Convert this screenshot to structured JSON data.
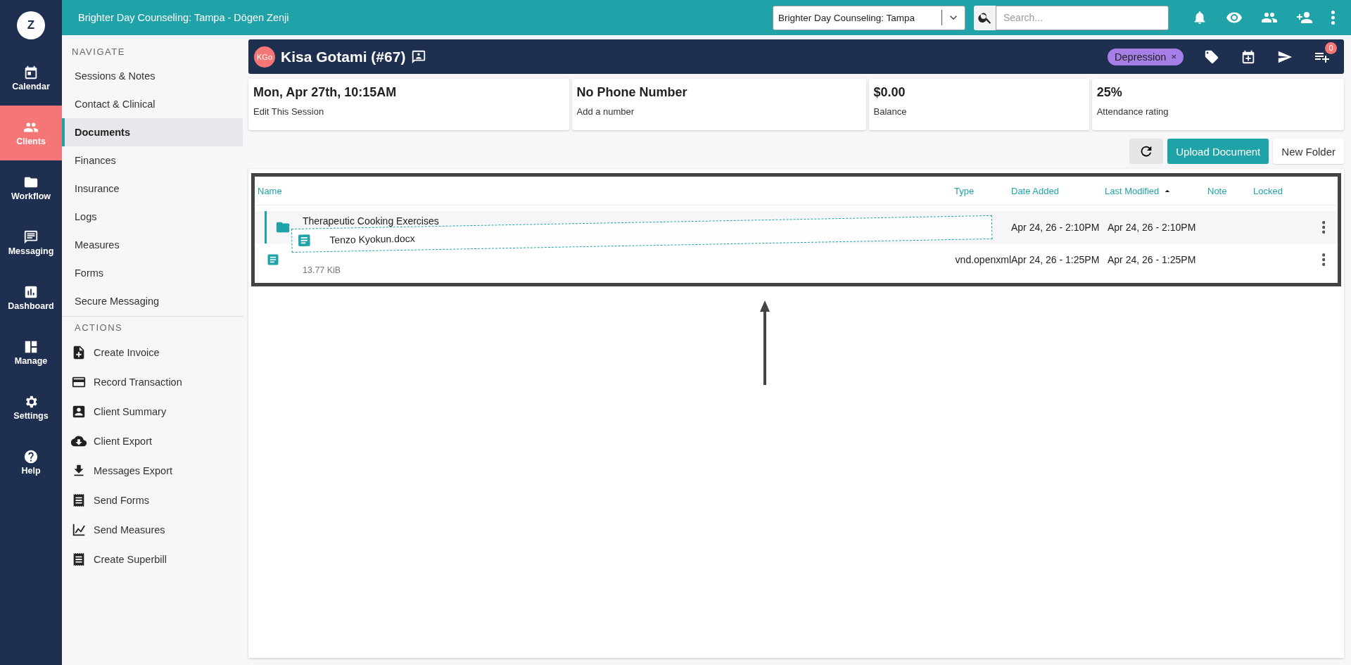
{
  "rail": {
    "logo": "Z",
    "items": [
      {
        "kind": "calendar",
        "label": "Calendar",
        "selected": false
      },
      {
        "kind": "people",
        "label": "Clients",
        "selected": true
      },
      {
        "kind": "folder",
        "label": "Workflow",
        "selected": false
      },
      {
        "kind": "message",
        "label": "Messaging",
        "selected": false
      },
      {
        "kind": "chart",
        "label": "Dashboard",
        "selected": false
      },
      {
        "kind": "layout",
        "label": "Manage",
        "selected": false
      },
      {
        "kind": "gear",
        "label": "Settings",
        "selected": false
      },
      {
        "kind": "help",
        "label": "Help",
        "selected": false
      }
    ]
  },
  "topbar": {
    "title": "Brighter Day Counseling: Tampa - Dōgen Zenji",
    "practice_select": "Brighter Day Counseling: Tampa",
    "search": {
      "placeholder": "Search..."
    }
  },
  "navigation": {
    "heading": "NAVIGATE",
    "items": [
      {
        "label": "Sessions & Notes",
        "selected": false
      },
      {
        "label": "Contact & Clinical",
        "selected": false
      },
      {
        "label": "Documents",
        "selected": true
      },
      {
        "label": "Finances",
        "selected": false
      },
      {
        "label": "Insurance",
        "selected": false
      },
      {
        "label": "Logs",
        "selected": false
      },
      {
        "label": "Measures",
        "selected": false
      },
      {
        "label": "Forms",
        "selected": false
      },
      {
        "label": "Secure Messaging",
        "selected": false
      }
    ]
  },
  "actions": {
    "heading": "ACTIONS",
    "items": [
      {
        "kind": "invoice",
        "label": "Create Invoice"
      },
      {
        "kind": "card",
        "label": "Record Transaction"
      },
      {
        "kind": "person",
        "label": "Client Summary"
      },
      {
        "kind": "cloud",
        "label": "Client Export"
      },
      {
        "kind": "download",
        "label": "Messages Export"
      },
      {
        "kind": "receipt",
        "label": "Send Forms"
      },
      {
        "kind": "graph",
        "label": "Send Measures"
      },
      {
        "kind": "receipt",
        "label": "Create Superbill"
      }
    ]
  },
  "client": {
    "initials": "KGo",
    "name": "Kisa Gotami (#67)",
    "tag": "Depression",
    "tag_remove": "×",
    "queue_count": "0"
  },
  "cards": [
    {
      "value": "Mon, Apr 27th, 10:15AM",
      "caption": "Edit This Session"
    },
    {
      "value": "No Phone Number",
      "caption": "Add a number"
    },
    {
      "value": "$0.00",
      "caption": "Balance"
    },
    {
      "value": "25%",
      "caption": "Attendance rating"
    }
  ],
  "toolbar": {
    "upload": "Upload Document",
    "new_folder": "New Folder"
  },
  "table": {
    "columns": [
      {
        "label": "Name",
        "sorted": false
      },
      {
        "label": "Type",
        "sorted": false
      },
      {
        "label": "Date Added",
        "sorted": false
      },
      {
        "label": "Last Modified",
        "sorted": true
      },
      {
        "label": "Note",
        "sorted": false
      },
      {
        "label": "Locked",
        "sorted": false
      }
    ],
    "rows": [
      {
        "kind": "folder",
        "name": "Therapeutic Cooking Exercises",
        "drop_target": true,
        "date_added": "Apr 24, 26 - 2:10PM",
        "last_modified": "Apr 24, 26 - 2:10PM"
      },
      {
        "kind": "file",
        "size": "13.77 KiB",
        "drop_target": false,
        "type": "vnd.openxml",
        "date_added": "Apr 24, 26 - 1:25PM",
        "last_modified": "Apr 24, 26 - 1:25PM"
      }
    ],
    "drag_ghost": {
      "name": "Tenzo Kyokun.docx"
    }
  }
}
